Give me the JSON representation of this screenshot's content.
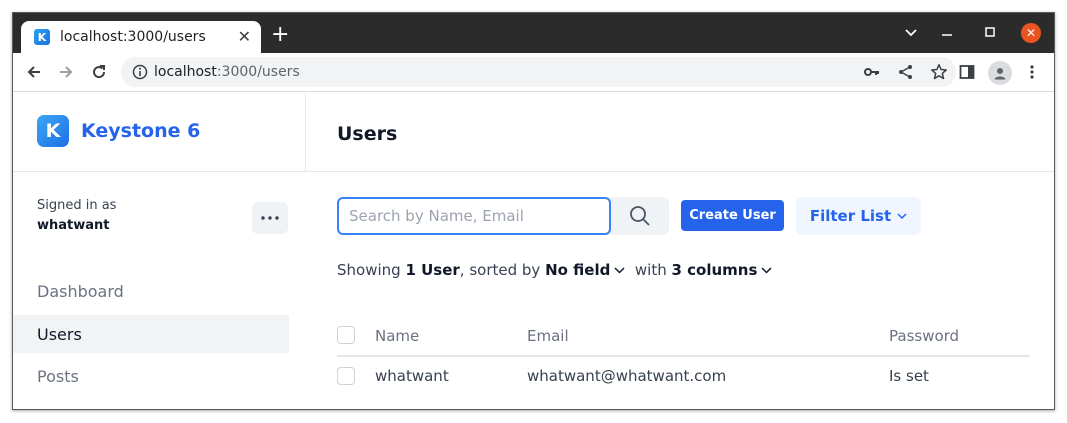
{
  "browser": {
    "tab_title": "localhost:3000/users",
    "favicon_letter": "K",
    "url_host": "localhost",
    "url_path": ":3000/users"
  },
  "app": {
    "brand_name": "Keystone 6",
    "brand_letter": "K",
    "brand_color": "#2563eb",
    "page_title": "Users",
    "signed_in_label": "Signed in as",
    "signed_in_user": "whatwant",
    "nav": [
      {
        "label": "Dashboard",
        "active": false
      },
      {
        "label": "Users",
        "active": true
      },
      {
        "label": "Posts",
        "active": false
      }
    ],
    "search_placeholder": "Search by Name, Email",
    "create_button": "Create User",
    "filter_button": "Filter List",
    "summary": {
      "showing": "Showing",
      "count": "1 User",
      "sorted_by": ", sorted by",
      "sort_field": "No field",
      "with": "with",
      "columns": "3 columns"
    },
    "table": {
      "headers": [
        "Name",
        "Email",
        "Password"
      ],
      "rows": [
        [
          "whatwant",
          "whatwant@whatwant.com",
          "Is set"
        ]
      ]
    }
  }
}
